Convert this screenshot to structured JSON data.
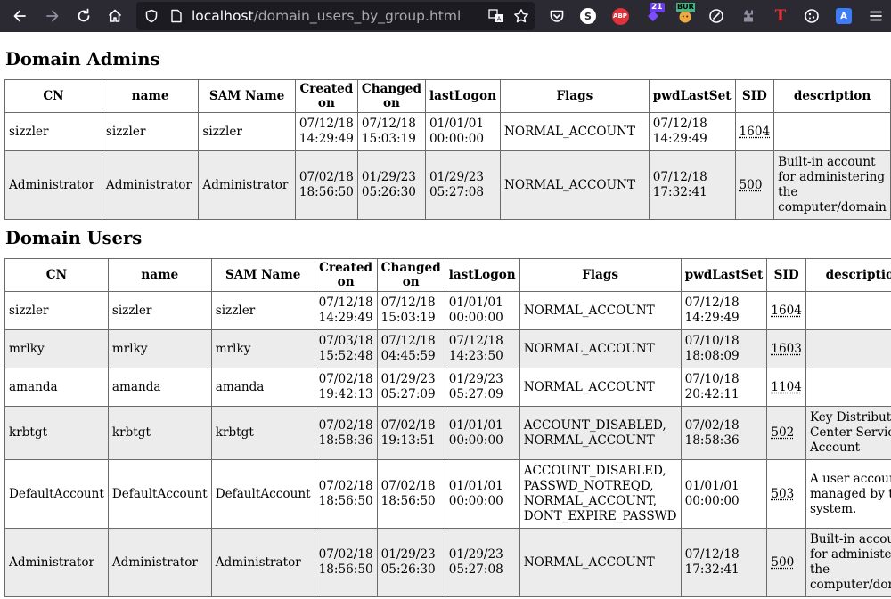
{
  "browser": {
    "url_host": "localhost",
    "url_path": "/domain_users_by_group.html",
    "ext_badge_count": "21",
    "ext_bur_label": "BUR",
    "ext_abp_label": "ABP",
    "ext_s_label": "S",
    "ext_t_label": "T",
    "icons": [
      "back-arrow-icon",
      "forward-arrow-icon",
      "reload-icon",
      "home-icon",
      "shield-icon",
      "page-icon",
      "translate-icon",
      "star-icon",
      "pocket-icon",
      "extension-icon",
      "menu-icon"
    ]
  },
  "headers": [
    "CN",
    "name",
    "SAM Name",
    "Created on",
    "Changed on",
    "lastLogon",
    "Flags",
    "pwdLastSet",
    "SID",
    "description"
  ],
  "groups": [
    {
      "title": "Domain Admins",
      "rows": [
        {
          "cn": "sizzler",
          "name": "sizzler",
          "sam": "sizzler",
          "created": "07/12/18\n14:29:49",
          "changed": "07/12/18\n15:03:19",
          "lastlogon": "01/01/01\n00:00:00",
          "flags": "NORMAL_ACCOUNT",
          "pwdlastset": "07/12/18\n14:29:49",
          "sid": "1604",
          "description": ""
        },
        {
          "cn": "Administrator",
          "name": "Administrator",
          "sam": "Administrator",
          "created": "07/02/18\n18:56:50",
          "changed": "01/29/23\n05:26:30",
          "lastlogon": "01/29/23\n05:27:08",
          "flags": "NORMAL_ACCOUNT",
          "pwdlastset": "07/12/18\n17:32:41",
          "sid": "500",
          "description": "Built-in account\nfor administering\nthe\ncomputer/domain"
        }
      ]
    },
    {
      "title": "Domain Users",
      "rows": [
        {
          "cn": "sizzler",
          "name": "sizzler",
          "sam": "sizzler",
          "created": "07/12/18\n14:29:49",
          "changed": "07/12/18\n15:03:19",
          "lastlogon": "01/01/01\n00:00:00",
          "flags": "NORMAL_ACCOUNT",
          "pwdlastset": "07/12/18\n14:29:49",
          "sid": "1604",
          "description": ""
        },
        {
          "cn": "mrlky",
          "name": "mrlky",
          "sam": "mrlky",
          "created": "07/03/18\n15:52:48",
          "changed": "07/12/18\n04:45:59",
          "lastlogon": "07/12/18\n14:23:50",
          "flags": "NORMAL_ACCOUNT",
          "pwdlastset": "07/10/18\n18:08:09",
          "sid": "1603",
          "description": ""
        },
        {
          "cn": "amanda",
          "name": "amanda",
          "sam": "amanda",
          "created": "07/02/18\n19:42:13",
          "changed": "01/29/23\n05:27:09",
          "lastlogon": "01/29/23\n05:27:09",
          "flags": "NORMAL_ACCOUNT",
          "pwdlastset": "07/10/18\n20:42:11",
          "sid": "1104",
          "description": ""
        },
        {
          "cn": "krbtgt",
          "name": "krbtgt",
          "sam": "krbtgt",
          "created": "07/02/18\n18:58:36",
          "changed": "07/02/18\n19:13:51",
          "lastlogon": "01/01/01\n00:00:00",
          "flags": "ACCOUNT_DISABLED,\nNORMAL_ACCOUNT",
          "pwdlastset": "07/02/18\n18:58:36",
          "sid": "502",
          "description": "Key Distribution\nCenter Service\nAccount"
        },
        {
          "cn": "DefaultAccount",
          "name": "DefaultAccount",
          "sam": "DefaultAccount",
          "created": "07/02/18\n18:56:50",
          "changed": "07/02/18\n18:56:50",
          "lastlogon": "01/01/01\n00:00:00",
          "flags": "ACCOUNT_DISABLED,\nPASSWD_NOTREQD,\nNORMAL_ACCOUNT,\nDONT_EXPIRE_PASSWD",
          "pwdlastset": "01/01/01\n00:00:00",
          "sid": "503",
          "description": "A user account\nmanaged by the\nsystem."
        },
        {
          "cn": "Administrator",
          "name": "Administrator",
          "sam": "Administrator",
          "created": "07/02/18\n18:56:50",
          "changed": "01/29/23\n05:26:30",
          "lastlogon": "01/29/23\n05:27:08",
          "flags": "NORMAL_ACCOUNT",
          "pwdlastset": "07/12/18\n17:32:41",
          "sid": "500",
          "description": "Built-in account\nfor administering\nthe\ncomputer/domain"
        }
      ]
    }
  ]
}
